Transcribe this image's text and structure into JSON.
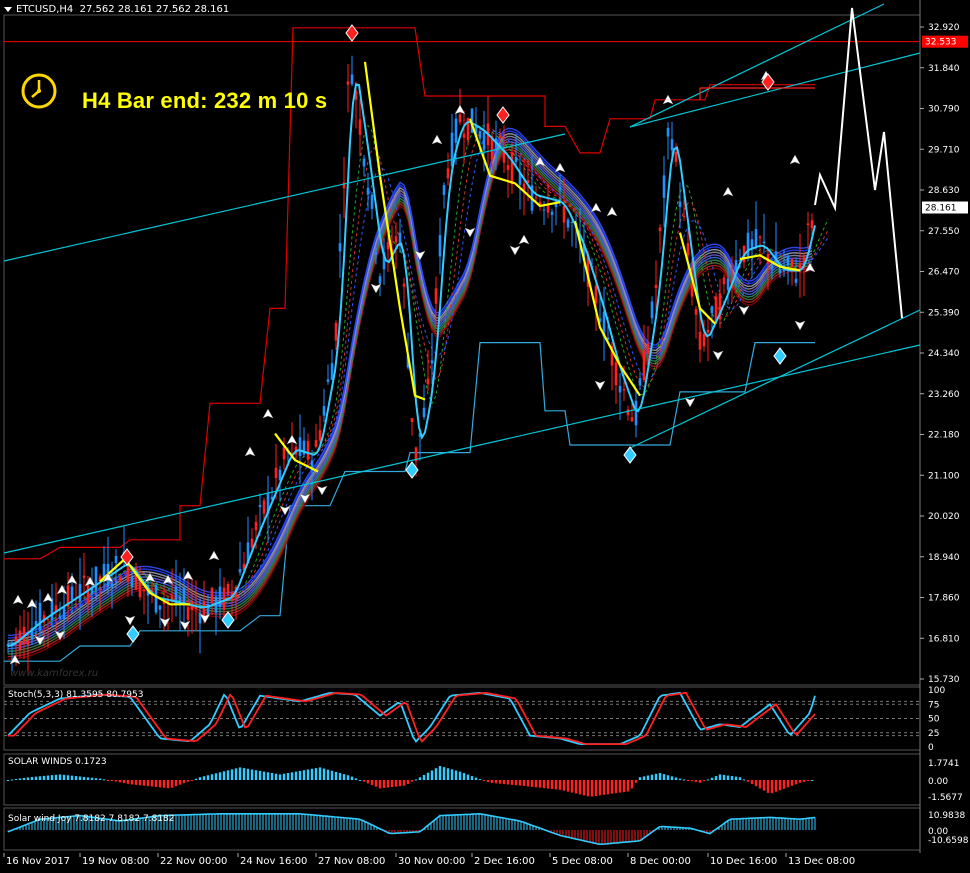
{
  "window": {
    "symbol": "ETCUSD",
    "timeframe": "H4",
    "ohlc": [
      "27.562",
      "28.161",
      "27.562",
      "28.161"
    ]
  },
  "countdown": {
    "text": "H4 Bar end: 232 m 10 s",
    "icon": "clock-icon"
  },
  "watermark": "www.kamforex.ru",
  "price_axis": {
    "ticks": [
      "32.920",
      "31.840",
      "30.790",
      "29.710",
      "28.630",
      "27.550",
      "26.470",
      "25.390",
      "24.340",
      "23.260",
      "22.180",
      "21.100",
      "20.020",
      "18.940",
      "17.860",
      "16.810",
      "15.730"
    ],
    "resistance_label": "32.533",
    "current_label": "28.161"
  },
  "time_axis": {
    "labels": [
      "16 Nov 2017",
      "19 Nov 08:00",
      "22 Nov 00:00",
      "24 Nov 16:00",
      "27 Nov 08:00",
      "30 Nov 00:00",
      "2 Dec 16:00",
      "5 Dec 08:00",
      "8 Dec 00:00",
      "10 Dec 16:00",
      "13 Dec 08:00"
    ]
  },
  "subpanels": {
    "stoch": {
      "title": "Stoch(5,3,3) 81.3595 80.7953",
      "levels": [
        "100",
        "80",
        "75",
        "50",
        "25",
        "20",
        "0"
      ]
    },
    "solar_winds": {
      "title": "SOLAR WINDS 0.1723",
      "levels": [
        "1.7741",
        "0.00",
        "-1.5677"
      ]
    },
    "solar_wind_joy": {
      "title": "Solar wind Joy 7.8182 7.8182 7.8182",
      "levels": [
        "10.9838",
        "0.00",
        "-10.6598"
      ]
    }
  },
  "colors": {
    "background": "#000000",
    "bull_candle": "#1e90ff",
    "bear_candle": "#ff2020",
    "trendline": "#00c8d8",
    "resistance": "#ff0000",
    "signal": "#ffff00",
    "forecast": "#ffffff"
  },
  "chart_data": {
    "type": "line",
    "symbol": "ETCUSD",
    "timeframe": "H4",
    "last_close": 28.161,
    "resistance_level": 32.533,
    "ylim": [
      15.73,
      33.5
    ]
  }
}
